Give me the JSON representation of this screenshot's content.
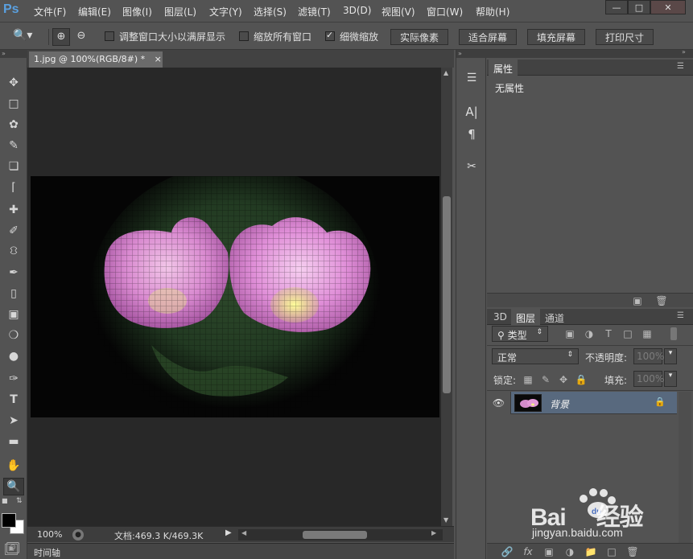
{
  "app": {
    "logo": "Ps"
  },
  "menu": [
    "文件(F)",
    "编辑(E)",
    "图像(I)",
    "图层(L)",
    "文字(Y)",
    "选择(S)",
    "滤镜(T)",
    "3D(D)",
    "视图(V)",
    "窗口(W)",
    "帮助(H)"
  ],
  "window_controls": {
    "minimize": "—",
    "restore": "□",
    "close": "✕"
  },
  "options_bar": {
    "checkboxes": [
      {
        "label": "调整窗口大小以满屏显示",
        "checked": false
      },
      {
        "label": "缩放所有窗口",
        "checked": false
      },
      {
        "label": "细微缩放",
        "checked": true
      }
    ],
    "buttons": [
      "实际像素",
      "适合屏幕",
      "填充屏幕",
      "打印尺寸"
    ]
  },
  "document": {
    "tab_title": "1.jpg @ 100%(RGB/8#) *",
    "tab_close": "×"
  },
  "status_bar": {
    "zoom": "100%",
    "doc_info": "文档:469.3 K/469.3K"
  },
  "timeline_label": "时间轴",
  "properties_panel": {
    "tab": "属性",
    "content": "无属性"
  },
  "layers_panel": {
    "tabs": [
      "3D",
      "图层",
      "通道"
    ],
    "active_tab": "图层",
    "filter_kind": "类型",
    "blend_mode": "正常",
    "opacity_label": "不透明度:",
    "opacity_value": "100%",
    "lock_label": "锁定:",
    "fill_label": "填充:",
    "fill_value": "100%",
    "layers": [
      {
        "name": "背景",
        "visible": true,
        "locked": true
      }
    ]
  },
  "colors": {
    "accent": "#5aa0e0",
    "ui_bg": "#535353",
    "canvas_bg": "#282828",
    "selected_layer": "#58697e"
  },
  "watermark": {
    "brand": "Bai du 经验",
    "url": "jingyan.baidu.com"
  }
}
